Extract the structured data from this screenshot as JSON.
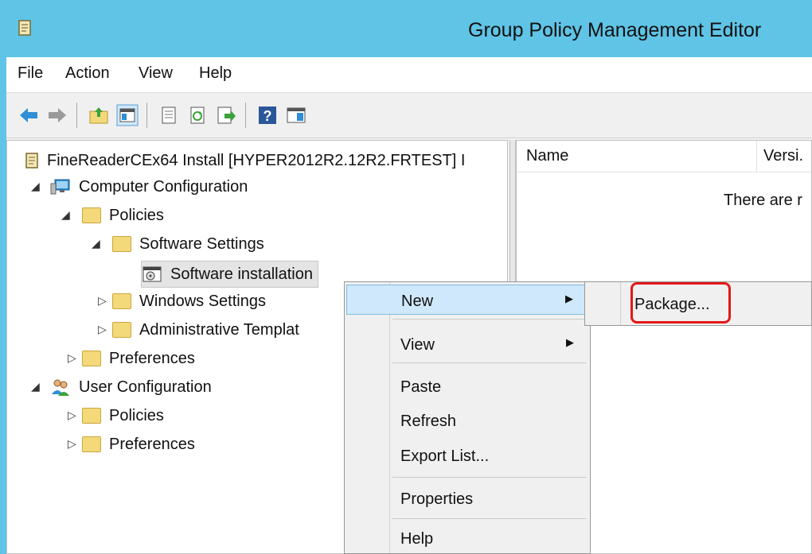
{
  "window": {
    "title": "Group Policy Management Editor",
    "icon": "gpo-scroll-icon"
  },
  "menubar": {
    "items": [
      "File",
      "Action",
      "View",
      "Help"
    ]
  },
  "toolbar": {
    "buttons": [
      "back-icon",
      "forward-icon",
      "up-folder-icon",
      "show-hide-tree-icon",
      "properties-icon",
      "refresh-icon",
      "export-list-icon",
      "help-icon",
      "show-action-pane-icon"
    ]
  },
  "tree": {
    "root": "FineReaderCEx64 Install [HYPER2012R2.12R2.FRTEST] I",
    "computer_config": "Computer Configuration",
    "policies": "Policies",
    "software_settings": "Software Settings",
    "software_installation": "Software installation",
    "windows_settings": "Windows Settings",
    "admin_templates": "Administrative Templat",
    "preferences": "Preferences",
    "user_config": "User Configuration",
    "user_policies": "Policies",
    "user_preferences": "Preferences"
  },
  "details": {
    "columns": [
      "Name",
      "Versi."
    ],
    "empty_message": "There are r"
  },
  "context_menu": {
    "items": [
      "New",
      "View",
      "Paste",
      "Refresh",
      "Export List...",
      "Properties",
      "Help"
    ]
  },
  "submenu": {
    "items": [
      "Package..."
    ]
  },
  "colors": {
    "titlebar": "#5fc4e6",
    "highlight": "#cfe8fb",
    "callout": "#e31818"
  }
}
